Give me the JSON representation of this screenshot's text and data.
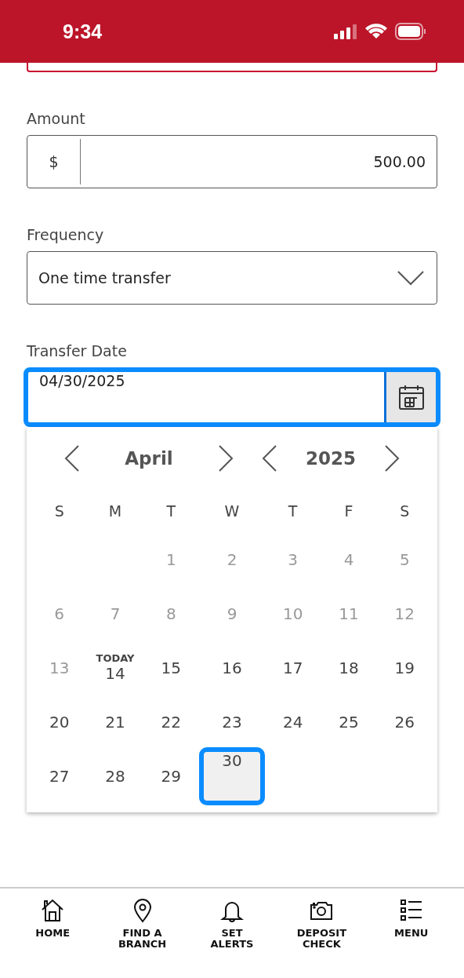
{
  "status_bar": {
    "time": "9:34"
  },
  "amount": {
    "label": "Amount",
    "currency": "$",
    "value": "500.00"
  },
  "frequency": {
    "label": "Frequency",
    "value": "One time transfer"
  },
  "transfer_date": {
    "label": "Transfer Date",
    "value": "04/30/2025",
    "focused": true
  },
  "calendar": {
    "month": "April",
    "year": "2025",
    "weekdays": [
      "S",
      "M",
      "T",
      "W",
      "T",
      "F",
      "S"
    ],
    "weeks": [
      [
        {
          "kind": "empty"
        },
        {
          "kind": "empty"
        },
        {
          "kind": "day",
          "label": "1",
          "disabled": true,
          "selected": false
        },
        {
          "kind": "day",
          "label": "2",
          "disabled": true,
          "selected": false
        },
        {
          "kind": "day",
          "label": "3",
          "disabled": true,
          "selected": false
        },
        {
          "kind": "day",
          "label": "4",
          "disabled": true,
          "selected": false
        },
        {
          "kind": "day",
          "label": "5",
          "disabled": true,
          "selected": false
        }
      ],
      [
        {
          "kind": "day",
          "label": "6",
          "disabled": true,
          "selected": false
        },
        {
          "kind": "day",
          "label": "7",
          "disabled": true,
          "selected": false
        },
        {
          "kind": "day",
          "label": "8",
          "disabled": true,
          "selected": false
        },
        {
          "kind": "day",
          "label": "9",
          "disabled": true,
          "selected": false
        },
        {
          "kind": "day",
          "label": "10",
          "disabled": true,
          "selected": false
        },
        {
          "kind": "day",
          "label": "11",
          "disabled": true,
          "selected": false
        },
        {
          "kind": "day",
          "label": "12",
          "disabled": true,
          "selected": false
        }
      ],
      [
        {
          "kind": "day",
          "label": "13",
          "disabled": true,
          "selected": false
        },
        {
          "kind": "today",
          "tag": "TODAY",
          "label": "14",
          "disabled": false,
          "selected": false
        },
        {
          "kind": "day",
          "label": "15",
          "disabled": false,
          "selected": false
        },
        {
          "kind": "day",
          "label": "16",
          "disabled": false,
          "selected": false
        },
        {
          "kind": "day",
          "label": "17",
          "disabled": false,
          "selected": false
        },
        {
          "kind": "day",
          "label": "18",
          "disabled": false,
          "selected": false
        },
        {
          "kind": "day",
          "label": "19",
          "disabled": false,
          "selected": false
        }
      ],
      [
        {
          "kind": "day",
          "label": "20",
          "disabled": false,
          "selected": false
        },
        {
          "kind": "day",
          "label": "21",
          "disabled": false,
          "selected": false
        },
        {
          "kind": "day",
          "label": "22",
          "disabled": false,
          "selected": false
        },
        {
          "kind": "day",
          "label": "23",
          "disabled": false,
          "selected": false
        },
        {
          "kind": "day",
          "label": "24",
          "disabled": false,
          "selected": false
        },
        {
          "kind": "day",
          "label": "25",
          "disabled": false,
          "selected": false
        },
        {
          "kind": "day",
          "label": "26",
          "disabled": false,
          "selected": false
        }
      ],
      [
        {
          "kind": "day",
          "label": "27",
          "disabled": false,
          "selected": false
        },
        {
          "kind": "day",
          "label": "28",
          "disabled": false,
          "selected": false
        },
        {
          "kind": "day",
          "label": "29",
          "disabled": false,
          "selected": false
        },
        {
          "kind": "day",
          "label": "30",
          "disabled": false,
          "selected": true
        }
      ]
    ]
  },
  "bottom_nav": [
    {
      "label": "HOME",
      "kind": "home"
    },
    {
      "label": "FIND A BRANCH",
      "kind": "branch"
    },
    {
      "label": "SET ALERTS",
      "kind": "alerts"
    },
    {
      "label": "DEPOSIT CHECK",
      "kind": "deposit"
    },
    {
      "label": "MENU",
      "kind": "menu"
    }
  ]
}
